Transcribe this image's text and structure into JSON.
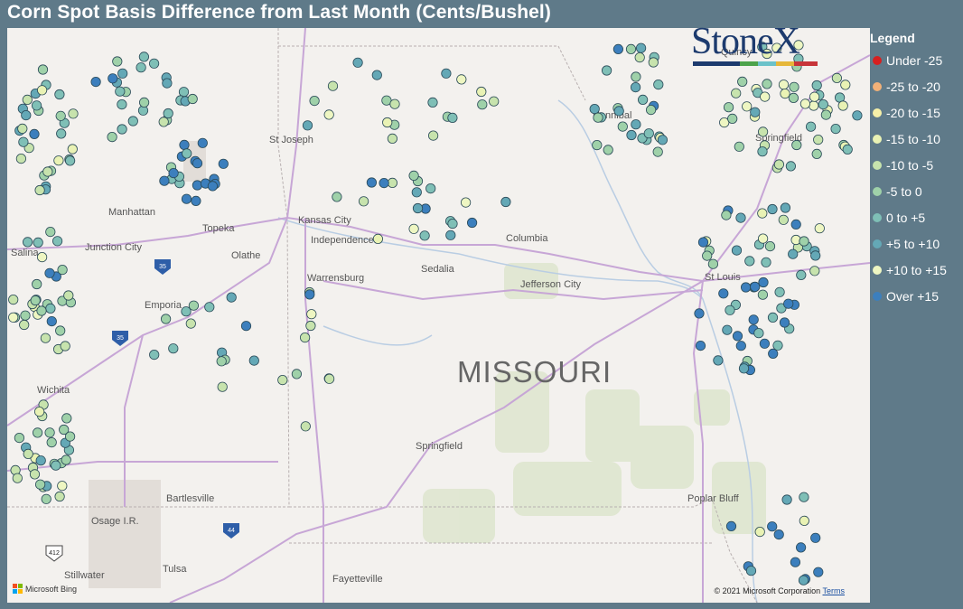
{
  "title": "Corn Spot Basis Difference from Last Month (Cents/Bushel)",
  "legend": {
    "title": "Legend",
    "items": [
      {
        "label": "Under -25",
        "color": "#d62020"
      },
      {
        "label": "-25 to -20",
        "color": "#f2b178"
      },
      {
        "label": "-20 to -15",
        "color": "#f6f0a8"
      },
      {
        "label": "-15 to -10",
        "color": "#e9f2b4"
      },
      {
        "label": "-10 to -5",
        "color": "#c7e3ad"
      },
      {
        "label": "-5 to 0",
        "color": "#9fd1a9"
      },
      {
        "label": "0 to +5",
        "color": "#7fbfb6"
      },
      {
        "label": "+5 to +10",
        "color": "#64a8b6"
      },
      {
        "label": "+10 to +15",
        "color": "#eef6c2"
      },
      {
        "label": "Over +15",
        "color": "#3c7fbd"
      }
    ]
  },
  "logo": {
    "text": "StoneX"
  },
  "map_labels": {
    "state": "MISSOURI",
    "cities": [
      "St Joseph",
      "Manhattan",
      "Topeka",
      "Kansas City",
      "Independence",
      "Junction City",
      "Salina",
      "Olathe",
      "Columbia",
      "Warrensburg",
      "Sedalia",
      "Jefferson City",
      "Emporia",
      "Wichita",
      "St Louis",
      "Springfield",
      "Bartlesville",
      "Osage I.R.",
      "Tulsa",
      "Stillwater",
      "Fayetteville",
      "Poplar Bluff"
    ],
    "highways": [
      "35",
      "35",
      "44",
      "412"
    ],
    "springfield_il": "Springfield",
    "hannibal": "Hannibal",
    "quincy": "Quincy"
  },
  "attribution": {
    "copyright": "© 2021 Microsoft Corporation",
    "terms": "Terms"
  },
  "bing": {
    "label": "Microsoft Bing"
  }
}
